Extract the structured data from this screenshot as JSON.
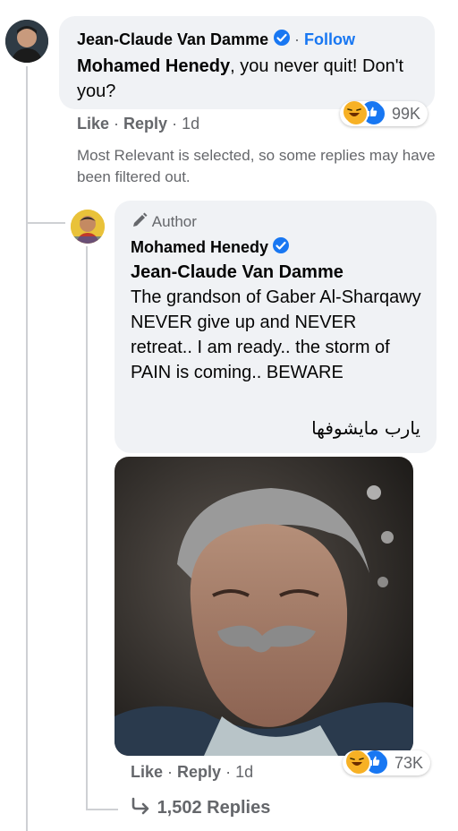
{
  "comment": {
    "author": "Jean-Claude Van Damme",
    "follow_label": "Follow",
    "mention": "Mohamed Henedy",
    "text": ", you never quit! Don't you?",
    "like_label": "Like",
    "reply_label": "Reply",
    "time": "1d",
    "reaction_count": "99K",
    "filter_notice": "Most Relevant is selected, so some replies may have been filtered out."
  },
  "reply": {
    "author_badge": "Author",
    "author": "Mohamed Henedy",
    "mention": "Jean-Claude Van Damme",
    "text": "The grandson of Gaber Al-Sharqawy NEVER give up and NEVER retreat.. I am ready.. the storm of PAIN is coming.. BEWARE",
    "arabic_text": "يارب مايشوفها",
    "like_label": "Like",
    "reply_label": "Reply",
    "time": "1d",
    "reaction_count": "73K"
  },
  "replies_link": "1,502 Replies",
  "icons": [
    "verified-badge-icon",
    "pencil-icon",
    "haha-reaction-icon",
    "like-reaction-icon",
    "reply-arrow-icon"
  ],
  "colors": {
    "link_blue": "#1877f2",
    "bubble_gray": "#f0f2f5",
    "meta_gray": "#65676b"
  }
}
